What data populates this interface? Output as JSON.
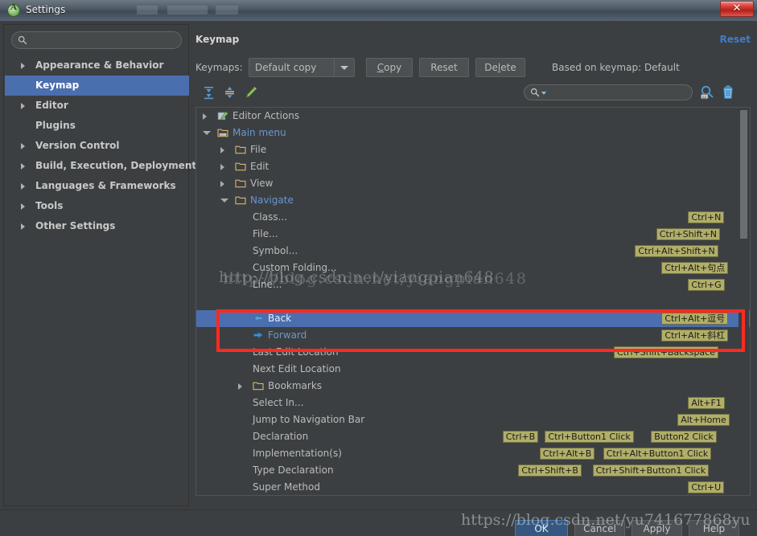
{
  "window": {
    "title": "Settings",
    "app_icon": "android-studio-icon",
    "close_label": "✕"
  },
  "sidebar": {
    "search": {
      "placeholder": "",
      "value": "",
      "icon": "search-icon"
    },
    "items": [
      {
        "label": "Appearance & Behavior",
        "expandable": true,
        "selected": false
      },
      {
        "label": "Keymap",
        "expandable": false,
        "selected": true
      },
      {
        "label": "Editor",
        "expandable": true,
        "selected": false
      },
      {
        "label": "Plugins",
        "expandable": false,
        "selected": false
      },
      {
        "label": "Version Control",
        "expandable": true,
        "selected": false
      },
      {
        "label": "Build, Execution, Deployment",
        "expandable": true,
        "selected": false
      },
      {
        "label": "Languages & Frameworks",
        "expandable": true,
        "selected": false
      },
      {
        "label": "Tools",
        "expandable": true,
        "selected": false
      },
      {
        "label": "Other Settings",
        "expandable": true,
        "selected": false
      }
    ]
  },
  "panel": {
    "title": "Keymap",
    "reset_link": "Reset",
    "keymaps_label": "Keymaps:",
    "keymap_selected": "Default copy",
    "buttons": {
      "copy": "Copy",
      "reset": "Reset",
      "delete": "Delete"
    },
    "based_on": "Based on keymap: Default",
    "toolbar": {
      "expand_all": "expand-all-icon",
      "collapse_all": "collapse-all-icon",
      "edit": "edit-pencil-icon",
      "find_shortcut": "find-by-shortcut-icon",
      "clear": "trash-icon"
    },
    "find": {
      "placeholder": "",
      "value": "",
      "icon": "search-icon"
    }
  },
  "tree": {
    "rows": [
      {
        "label": "Editor Actions",
        "indent": 0,
        "expander": "closed",
        "icon": "editor-actions-icon",
        "color": "normal",
        "shortcuts": []
      },
      {
        "label": "Main menu",
        "indent": 0,
        "expander": "open",
        "icon": "menu-icon",
        "color": "blue",
        "shortcuts": []
      },
      {
        "label": "File",
        "indent": 1,
        "expander": "closed",
        "icon": "folder-icon",
        "color": "normal",
        "shortcuts": []
      },
      {
        "label": "Edit",
        "indent": 1,
        "expander": "closed",
        "icon": "folder-icon",
        "color": "normal",
        "shortcuts": []
      },
      {
        "label": "View",
        "indent": 1,
        "expander": "closed",
        "icon": "folder-icon",
        "color": "normal",
        "shortcuts": []
      },
      {
        "label": "Navigate",
        "indent": 1,
        "expander": "open",
        "icon": "folder-icon",
        "color": "blue",
        "shortcuts": []
      },
      {
        "label": "Class...",
        "indent": 2,
        "expander": "none",
        "icon": "none",
        "color": "normal",
        "shortcuts": [
          "Ctrl+N"
        ]
      },
      {
        "label": "File...",
        "indent": 2,
        "expander": "none",
        "icon": "none",
        "color": "normal",
        "shortcuts": [
          "Ctrl+Shift+N"
        ]
      },
      {
        "label": "Symbol...",
        "indent": 2,
        "expander": "none",
        "icon": "none",
        "color": "normal",
        "shortcuts": [
          "Ctrl+Alt+Shift+N"
        ]
      },
      {
        "label": "Custom Folding...",
        "indent": 2,
        "expander": "none",
        "icon": "none",
        "color": "normal",
        "shortcuts": [
          "Ctrl+Alt+句点"
        ]
      },
      {
        "label": "Line...",
        "indent": 2,
        "expander": "none",
        "icon": "none",
        "color": "normal",
        "shortcuts": [
          "Ctrl+G"
        ]
      },
      {
        "label": "",
        "indent": 2,
        "expander": "none",
        "icon": "none",
        "color": "normal",
        "shortcuts": []
      },
      {
        "label": "Back",
        "indent": 2,
        "expander": "none",
        "icon": "back-arrow-icon",
        "color": "blue",
        "selected": true,
        "shortcuts": [
          "Ctrl+Alt+逗号"
        ]
      },
      {
        "label": "Forward",
        "indent": 2,
        "expander": "none",
        "icon": "forward-arrow-icon",
        "color": "blue",
        "shortcuts": [
          "Ctrl+Alt+斜杠"
        ]
      },
      {
        "label": "Last Edit Location",
        "indent": 2,
        "expander": "none",
        "icon": "none",
        "color": "normal",
        "shortcuts": [
          "Ctrl+Shift+Backspace"
        ]
      },
      {
        "label": "Next Edit Location",
        "indent": 2,
        "expander": "none",
        "icon": "none",
        "color": "normal",
        "shortcuts": []
      },
      {
        "label": "Bookmarks",
        "indent": 2,
        "expander": "closed",
        "icon": "folder-icon",
        "color": "normal",
        "shortcuts": []
      },
      {
        "label": "Select In...",
        "indent": 2,
        "expander": "none",
        "icon": "none",
        "color": "normal",
        "shortcuts": [
          "Alt+F1"
        ]
      },
      {
        "label": "Jump to Navigation Bar",
        "indent": 2,
        "expander": "none",
        "icon": "none",
        "color": "normal",
        "shortcuts": [
          "Alt+Home"
        ]
      },
      {
        "label": "Declaration",
        "indent": 2,
        "expander": "none",
        "icon": "none",
        "color": "normal",
        "shortcuts": [
          "Ctrl+B",
          "Ctrl+Button1 Click",
          "Button2 Click"
        ]
      },
      {
        "label": "Implementation(s)",
        "indent": 2,
        "expander": "none",
        "icon": "none",
        "color": "normal",
        "shortcuts": [
          "Ctrl+Alt+B",
          "Ctrl+Alt+Button1 Click"
        ]
      },
      {
        "label": "Type Declaration",
        "indent": 2,
        "expander": "none",
        "icon": "none",
        "color": "normal",
        "shortcuts": [
          "Ctrl+Shift+B",
          "Ctrl+Shift+Button1 Click"
        ]
      },
      {
        "label": "Super Method",
        "indent": 2,
        "expander": "none",
        "icon": "none",
        "color": "normal",
        "shortcuts": [
          "Ctrl+U"
        ]
      }
    ]
  },
  "footer": {
    "ok": "OK",
    "cancel": "Cancel",
    "apply": "Apply",
    "help": "Help"
  },
  "watermarks": {
    "tree": "http://blog.csdn.net/yiangpian648",
    "bottom": "https://blog.csdn.net/yu741677868yu"
  },
  "colors": {
    "accent_selection": "#4b6eaf",
    "link": "#3d7ecb",
    "shortcut_badge": "#b0ae68",
    "annotation_red": "#ff2a20",
    "folder": "#d9b26f"
  }
}
